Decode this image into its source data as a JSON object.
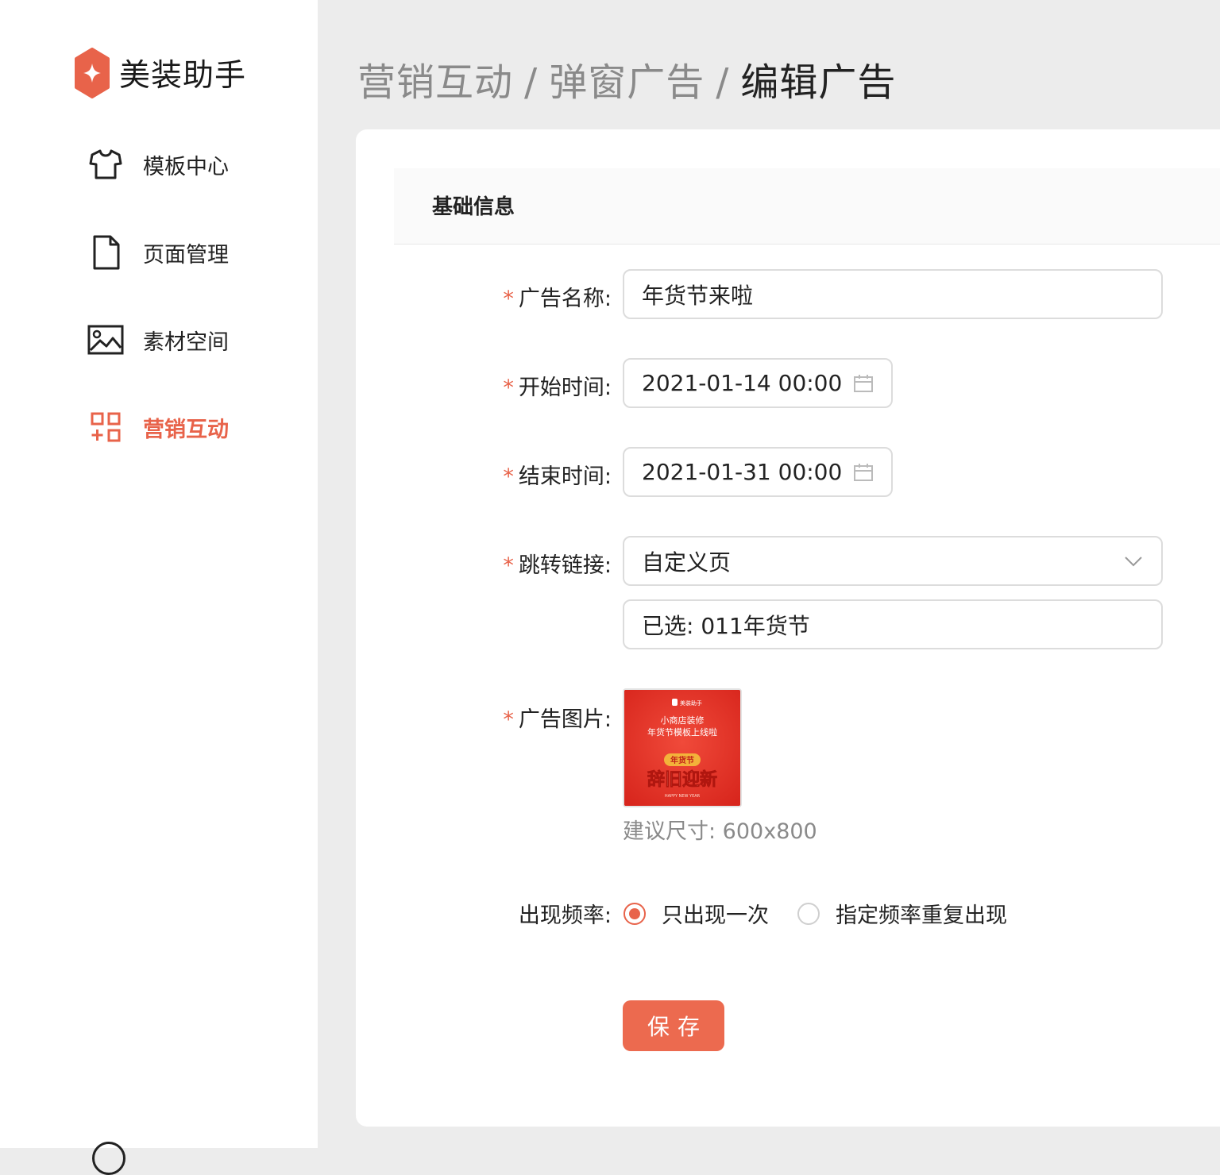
{
  "app": {
    "name": "美装助手",
    "brand_color": "#e8634a"
  },
  "sidebar": {
    "items": [
      {
        "label": "模板中心",
        "icon": "tshirt-icon",
        "active": false
      },
      {
        "label": "页面管理",
        "icon": "document-icon",
        "active": false
      },
      {
        "label": "素材空间",
        "icon": "image-icon",
        "active": false
      },
      {
        "label": "营销互动",
        "icon": "apps-icon",
        "active": true
      }
    ]
  },
  "breadcrumb": {
    "items": [
      "营销互动",
      "弹窗广告",
      "编辑广告"
    ],
    "separator": "/"
  },
  "form": {
    "section_title": "基础信息",
    "required_mark": "*",
    "ad_name": {
      "label": "广告名称:",
      "value": "年货节来啦"
    },
    "start_time": {
      "label": "开始时间:",
      "value": "2021-01-14 00:00",
      "icon": "calendar-icon"
    },
    "end_time": {
      "label": "结束时间:",
      "value": "2021-01-31 00:00",
      "icon": "calendar-icon"
    },
    "jump_link": {
      "label": "跳转链接:",
      "value": "自定义页",
      "icon": "chevron-down-icon",
      "selected": "已选: 011年货节"
    },
    "ad_image": {
      "label": "广告图片:",
      "hint": "建议尺寸: 600x800",
      "poster": {
        "brand": "美装助手",
        "line1": "小商店装修",
        "line2": "年货节模板上线啦",
        "badge": "年货节",
        "headline": "辞旧迎新",
        "footer": "HAPPY NEW YEAR"
      }
    },
    "frequency": {
      "label": "出现频率:",
      "options": [
        {
          "label": "只出现一次",
          "checked": true
        },
        {
          "label": "指定频率重复出现",
          "checked": false
        }
      ]
    },
    "save_label": "保存"
  }
}
